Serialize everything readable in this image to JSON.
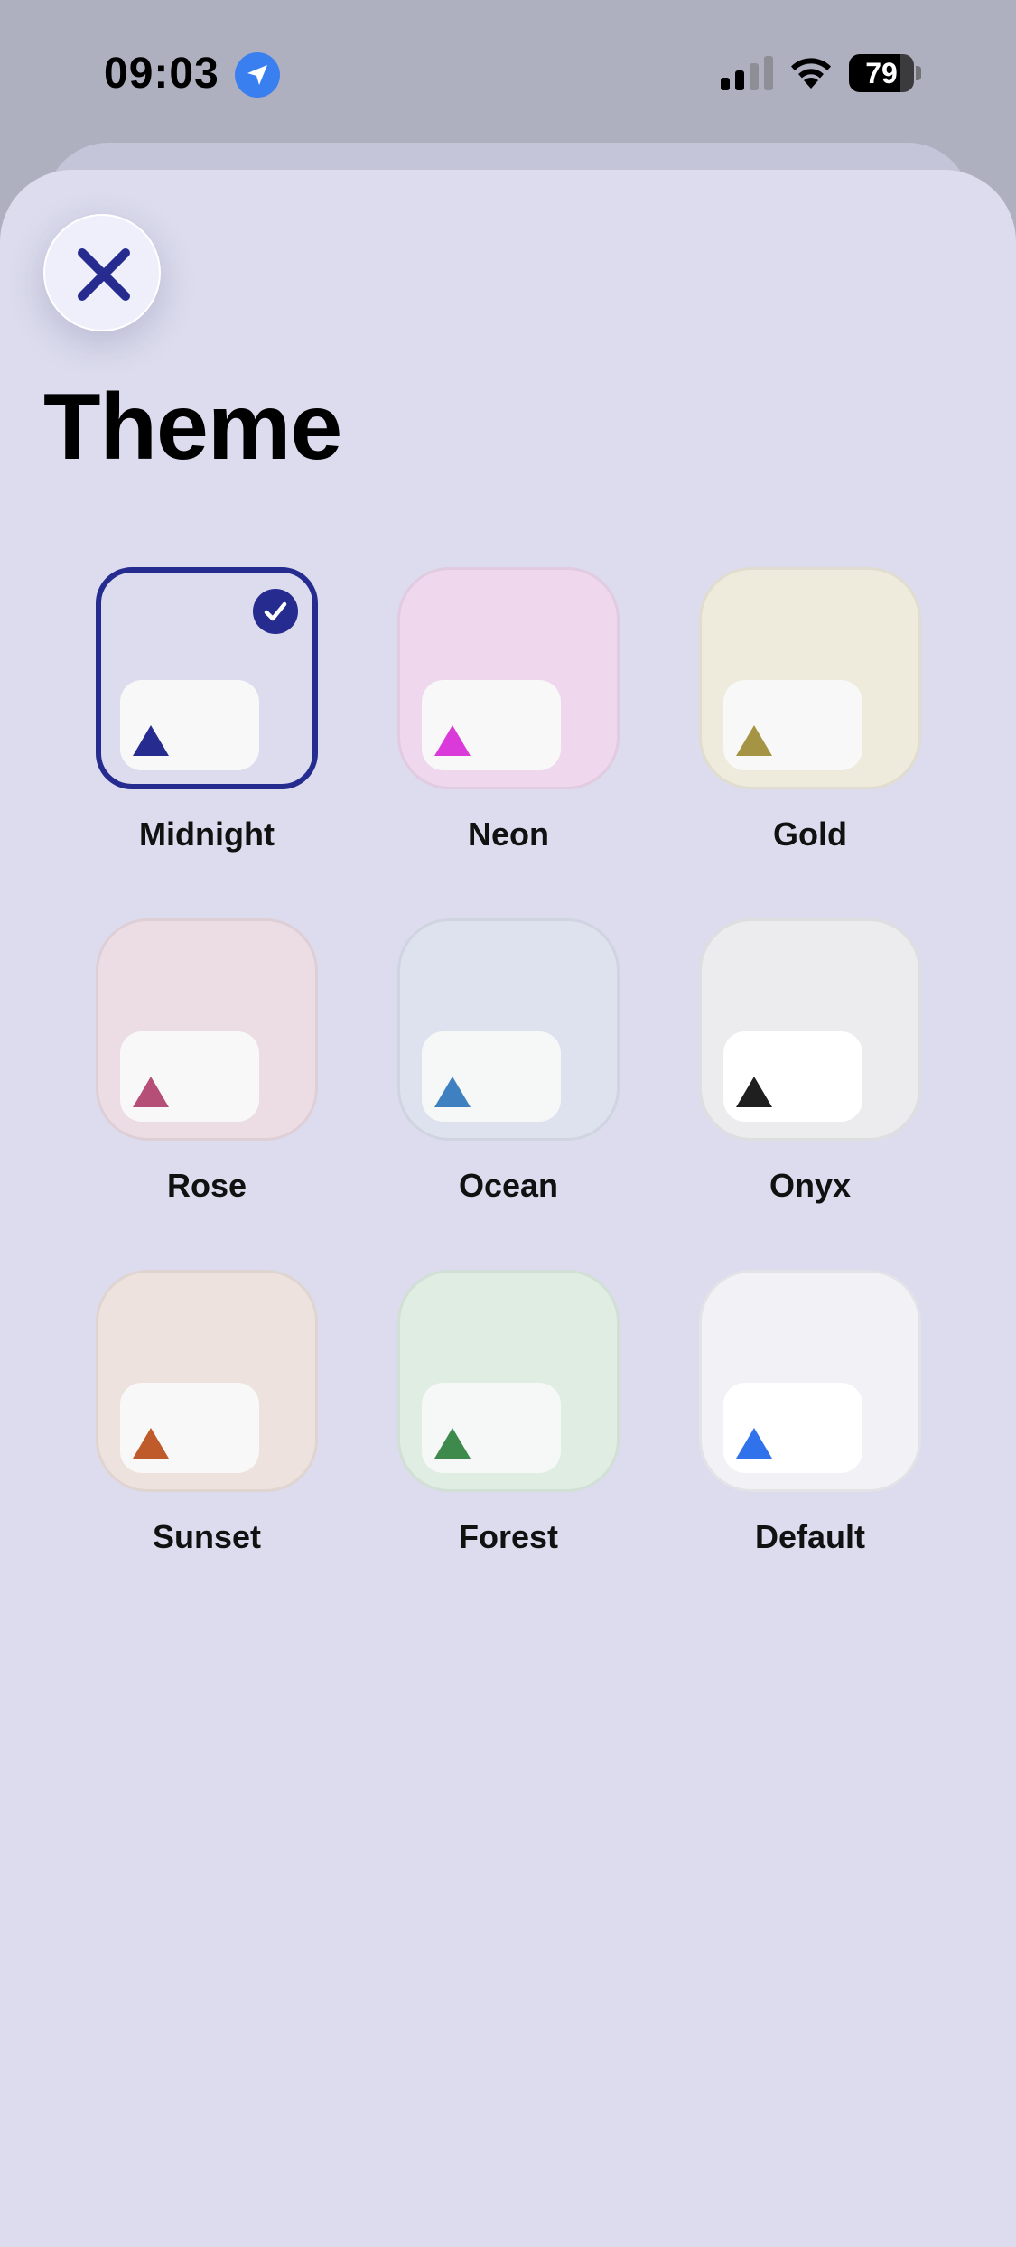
{
  "status_bar": {
    "time": "09:03",
    "battery_level": "79",
    "battery_percent": 79,
    "signal_bars_active": 2,
    "signal_bars_total": 4,
    "icons": [
      "location-arrow-icon",
      "cellular-signal-icon",
      "wifi-icon",
      "battery-icon"
    ]
  },
  "sheet": {
    "close_icon": "close-icon",
    "title": "Theme"
  },
  "themes": [
    {
      "name": "Midnight",
      "selected": true,
      "tile_color": "#dcdcee",
      "card_color": "#f8f8f8",
      "accent": "#262b8f"
    },
    {
      "name": "Neon",
      "selected": false,
      "tile_color": "#efd8ee",
      "card_color": "#f8f8f8",
      "accent": "#d93ad9"
    },
    {
      "name": "Gold",
      "selected": false,
      "tile_color": "#eeebdd",
      "card_color": "#f8f8f8",
      "accent": "#a69445"
    },
    {
      "name": "Rose",
      "selected": false,
      "tile_color": "#ecdce4",
      "card_color": "#f8f8f8",
      "accent": "#b54f78"
    },
    {
      "name": "Ocean",
      "selected": false,
      "tile_color": "#dee2ee",
      "card_color": "#f6f7f7",
      "accent": "#3f80c0"
    },
    {
      "name": "Onyx",
      "selected": false,
      "tile_color": "#ececee",
      "card_color": "#ffffff",
      "accent": "#1f1f1f"
    },
    {
      "name": "Sunset",
      "selected": false,
      "tile_color": "#ede2de",
      "card_color": "#f8f8f8",
      "accent": "#bf5a2a"
    },
    {
      "name": "Forest",
      "selected": false,
      "tile_color": "#dfede3",
      "card_color": "#f6f7f7",
      "accent": "#3e8a4c"
    },
    {
      "name": "Default",
      "selected": false,
      "tile_color": "#f1f1f6",
      "card_color": "#ffffff",
      "accent": "#2f72eb"
    }
  ],
  "colors": {
    "background": "#aeafbf",
    "sheet": "#dcdcee",
    "selection": "#262b8f",
    "location_blue": "#3a7ff0"
  }
}
